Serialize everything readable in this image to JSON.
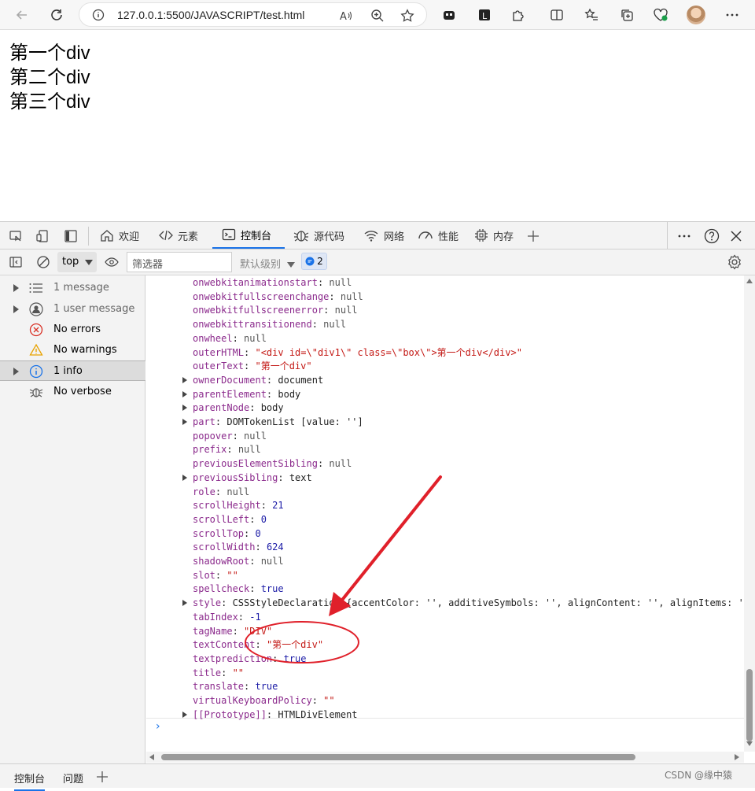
{
  "browser": {
    "url": "127.0.0.1:5500/JAVASCRIPT/test.html"
  },
  "page": {
    "lines": [
      "第一个div",
      "第二个div",
      "第三个div"
    ]
  },
  "devtools": {
    "tabs": [
      "欢迎",
      "元素",
      "控制台",
      "源代码",
      "网络",
      "性能",
      "内存"
    ]
  },
  "console_toolbar": {
    "context": "top",
    "filter_placeholder": "筛选器",
    "levels": "默认级别",
    "issues_count": "2"
  },
  "sidebar": {
    "items": [
      "1 message",
      "1 user message",
      "No errors",
      "No warnings",
      "1 info",
      "No verbose"
    ]
  },
  "console": {
    "lines": [
      {
        "key": "onwebkitanimationstart",
        "value": "null",
        "kind": "null",
        "expand": false
      },
      {
        "key": "onwebkitfullscreenchange",
        "value": "null",
        "kind": "null",
        "expand": false
      },
      {
        "key": "onwebkitfullscreenerror",
        "value": "null",
        "kind": "null",
        "expand": false
      },
      {
        "key": "onwebkittransitionend",
        "value": "null",
        "kind": "null",
        "expand": false
      },
      {
        "key": "onwheel",
        "value": "null",
        "kind": "null",
        "expand": false
      },
      {
        "key": "outerHTML",
        "value": "\"<div id=\\\"div1\\\" class=\\\"box\\\">第一个div</div>\"",
        "kind": "str",
        "expand": false
      },
      {
        "key": "outerText",
        "value": "\"第一个div\"",
        "kind": "str",
        "expand": false
      },
      {
        "key": "ownerDocument",
        "value": "document",
        "kind": "obj",
        "expand": true
      },
      {
        "key": "parentElement",
        "value": "body",
        "kind": "obj",
        "expand": true
      },
      {
        "key": "parentNode",
        "value": "body",
        "kind": "obj",
        "expand": true
      },
      {
        "key": "part",
        "value": "DOMTokenList [value: '']",
        "kind": "obj",
        "expand": true
      },
      {
        "key": "popover",
        "value": "null",
        "kind": "null",
        "expand": false
      },
      {
        "key": "prefix",
        "value": "null",
        "kind": "null",
        "expand": false
      },
      {
        "key": "previousElementSibling",
        "value": "null",
        "kind": "null",
        "expand": false
      },
      {
        "key": "previousSibling",
        "value": "text",
        "kind": "obj",
        "expand": true
      },
      {
        "key": "role",
        "value": "null",
        "kind": "null",
        "expand": false
      },
      {
        "key": "scrollHeight",
        "value": "21",
        "kind": "num",
        "expand": false
      },
      {
        "key": "scrollLeft",
        "value": "0",
        "kind": "num",
        "expand": false
      },
      {
        "key": "scrollTop",
        "value": "0",
        "kind": "num",
        "expand": false
      },
      {
        "key": "scrollWidth",
        "value": "624",
        "kind": "num",
        "expand": false
      },
      {
        "key": "shadowRoot",
        "value": "null",
        "kind": "null",
        "expand": false
      },
      {
        "key": "slot",
        "value": "\"\"",
        "kind": "str",
        "expand": false
      },
      {
        "key": "spellcheck",
        "value": "true",
        "kind": "bool",
        "expand": false
      },
      {
        "key": "style",
        "value": "CSSStyleDeclaration {accentColor: '', additiveSymbols: '', alignContent: '', alignItems: '',",
        "kind": "obj",
        "expand": true
      },
      {
        "key": "tabIndex",
        "value": "-1",
        "kind": "num",
        "expand": false
      },
      {
        "key": "tagName",
        "value": "\"DIV\"",
        "kind": "str",
        "expand": false
      },
      {
        "key": "textContent",
        "value": "\"第一个div\"",
        "kind": "str",
        "expand": false
      },
      {
        "key": "textprediction",
        "value": "true",
        "kind": "bool",
        "expand": false
      },
      {
        "key": "title",
        "value": "\"\"",
        "kind": "str",
        "expand": false
      },
      {
        "key": "translate",
        "value": "true",
        "kind": "bool",
        "expand": false
      },
      {
        "key": "virtualKeyboardPolicy",
        "value": "\"\"",
        "kind": "str",
        "expand": false
      },
      {
        "key": "[[Prototype]]",
        "value": "HTMLDivElement",
        "kind": "obj",
        "expand": true
      }
    ]
  },
  "drawer": {
    "tabs": [
      "控制台",
      "问题"
    ]
  },
  "watermark": "CSDN @缘中猿",
  "colors": {
    "accent": "#1a73e8",
    "annotation": "#e0202a"
  }
}
